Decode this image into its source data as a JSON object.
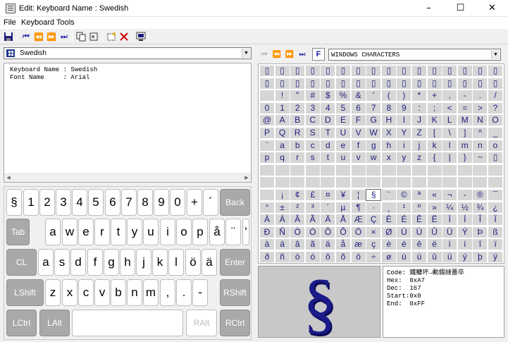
{
  "window": {
    "title": "Edit:  Keyboard Name : Swedish",
    "controls": [
      "–",
      "☐",
      "✕"
    ]
  },
  "menu": [
    "File",
    "Keyboard",
    "Tools"
  ],
  "toolbar": {
    "icons": [
      "save-icon",
      "first-icon",
      "prev-icon",
      "next-icon",
      "last-icon",
      "copy-icon",
      "sound-icon",
      "new-icon",
      "delete-icon",
      "screen-icon"
    ]
  },
  "keyboard_select": {
    "value": "Swedish"
  },
  "info": {
    "lines": [
      "Keyboard Name : Swedish",
      "Font Name     : Arial"
    ]
  },
  "keys": {
    "row1": [
      "§",
      "1",
      "2",
      "3",
      "4",
      "5",
      "6",
      "7",
      "8",
      "9",
      "0",
      "+",
      "´",
      "Back"
    ],
    "row2": [
      "Tab",
      "a",
      "w",
      "e",
      "r",
      "t",
      "y",
      "u",
      "i",
      "o",
      "p",
      "å",
      "¨",
      "'"
    ],
    "row3": [
      "CL",
      "a",
      "s",
      "d",
      "f",
      "g",
      "h",
      "j",
      "k",
      "l",
      "ö",
      "ä",
      "Enter"
    ],
    "row4": [
      "LShift",
      "z",
      "x",
      "c",
      "v",
      "b",
      "n",
      "m",
      ",",
      ".",
      "-",
      "RShift"
    ],
    "row5": [
      "LCtrl",
      "LAlt",
      "",
      "RAlt",
      "RCtrl"
    ]
  },
  "charset": {
    "value": "WINDOWS CHARACTERS",
    "f_label": "F"
  },
  "char_grid": [
    [
      "▯",
      "▯",
      "▯",
      "▯",
      "▯",
      "▯",
      "▯",
      "▯",
      "▯",
      "▯",
      "▯",
      "▯",
      "▯",
      "▯",
      "▯",
      "▯"
    ],
    [
      "▯",
      "▯",
      "▯",
      "▯",
      "▯",
      "▯",
      "▯",
      "▯",
      "▯",
      "▯",
      "▯",
      "▯",
      "▯",
      "▯",
      "▯",
      "▯"
    ],
    [
      "",
      "!",
      "\"",
      "#",
      "$",
      "%",
      "&",
      "'",
      "(",
      ")",
      "*",
      "+",
      ",",
      "-",
      ".",
      "/"
    ],
    [
      "0",
      "1",
      "2",
      "3",
      "4",
      "5",
      "6",
      "7",
      "8",
      "9",
      ":",
      ";",
      "<",
      "=",
      ">",
      "?"
    ],
    [
      "@",
      "A",
      "B",
      "C",
      "D",
      "E",
      "F",
      "G",
      "H",
      "I",
      "J",
      "K",
      "L",
      "M",
      "N",
      "O"
    ],
    [
      "P",
      "Q",
      "R",
      "S",
      "T",
      "U",
      "V",
      "W",
      "X",
      "Y",
      "Z",
      "[",
      "\\",
      "]",
      "^",
      "_"
    ],
    [
      "`",
      "a",
      "b",
      "c",
      "d",
      "e",
      "f",
      "g",
      "h",
      "i",
      "j",
      "k",
      "l",
      "m",
      "n",
      "o"
    ],
    [
      "p",
      "q",
      "r",
      "s",
      "t",
      "u",
      "v",
      "w",
      "x",
      "y",
      "z",
      "{",
      "|",
      "}",
      "~",
      "▯"
    ],
    [
      "",
      "",
      "",
      "",
      "",
      "",
      "",
      "",
      "",
      "",
      "",
      "",
      "",
      "",
      "",
      ""
    ],
    [
      "",
      "",
      "",
      "",
      "",
      "",
      "",
      "",
      "",
      "",
      "",
      "",
      "",
      "",
      "",
      ""
    ],
    [
      "",
      "¡",
      "¢",
      "£",
      "¤",
      "¥",
      "¦",
      "§",
      "¨",
      "©",
      "ª",
      "«",
      "¬",
      "-",
      "®",
      "¯"
    ],
    [
      "°",
      "±",
      "²",
      "³",
      "´",
      "µ",
      "¶",
      "·",
      "¸",
      "¹",
      "º",
      "»",
      "¼",
      "½",
      "¾",
      "¿"
    ],
    [
      "À",
      "Á",
      "Â",
      "Ã",
      "Ä",
      "Å",
      "Æ",
      "Ç",
      "È",
      "É",
      "Ê",
      "Ë",
      "Ì",
      "Í",
      "Î",
      "Ï"
    ],
    [
      "Ð",
      "Ñ",
      "Ò",
      "Ó",
      "Ô",
      "Õ",
      "Ö",
      "×",
      "Ø",
      "Ù",
      "Ú",
      "Û",
      "Ü",
      "Ý",
      "Þ",
      "ß"
    ],
    [
      "à",
      "á",
      "â",
      "ã",
      "ä",
      "å",
      "æ",
      "ç",
      "è",
      "é",
      "ê",
      "ë",
      "ì",
      "í",
      "î",
      "ï"
    ],
    [
      "ð",
      "ñ",
      "ò",
      "ó",
      "ô",
      "õ",
      "ö",
      "÷",
      "ø",
      "ù",
      "ú",
      "û",
      "ü",
      "ý",
      "þ",
      "ÿ"
    ]
  ],
  "selected_char": "§",
  "details": {
    "lines": [
      "Code: 鐵鱇坏→動錫縫薔卒",
      "Hex:  0xA7",
      "Dec:  167",
      "Start:0x0",
      "End:  0xFF"
    ]
  }
}
